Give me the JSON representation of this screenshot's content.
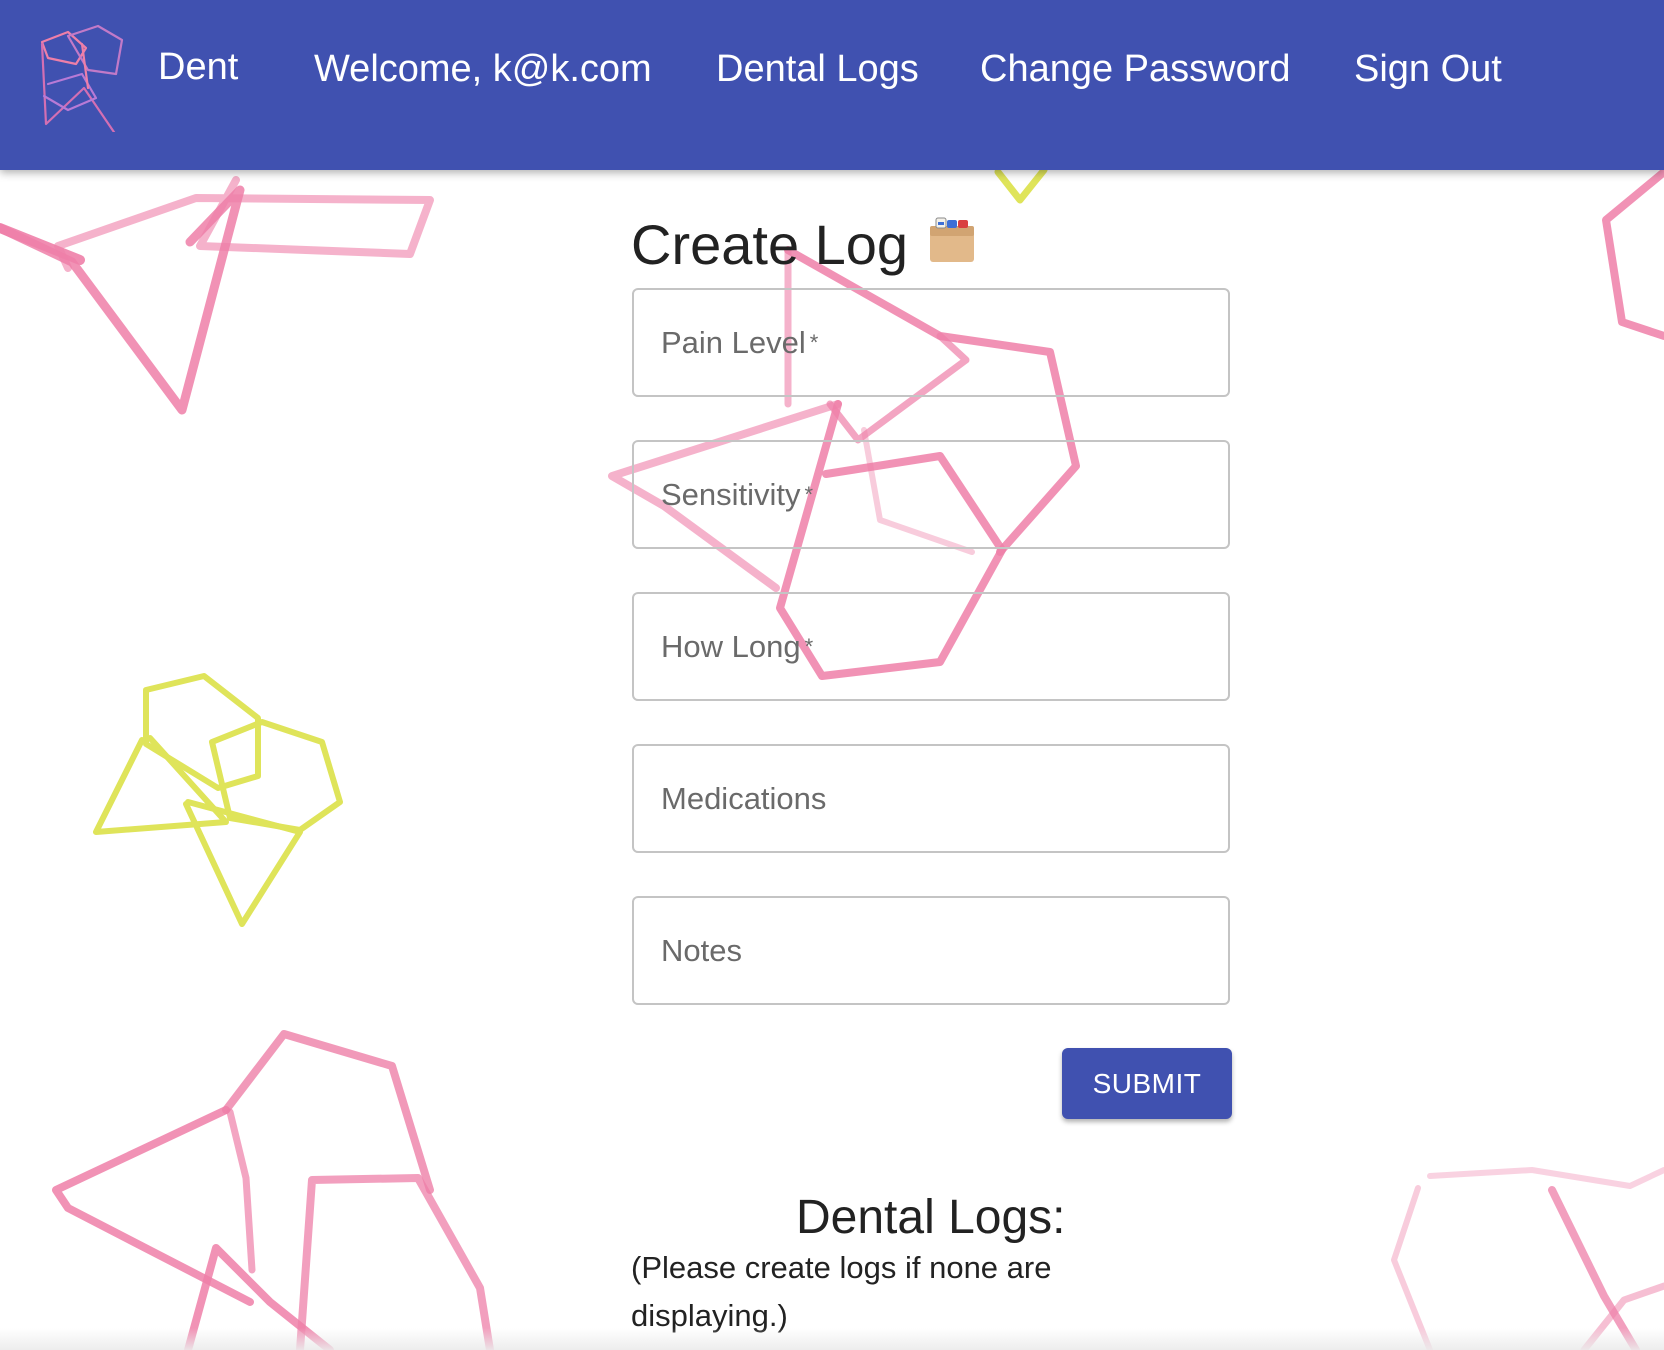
{
  "header": {
    "brand": "Dent",
    "welcome": "Welcome, k@k.com",
    "nav": {
      "dental_logs": "Dental Logs",
      "change_password": "Change Password",
      "sign_out": "Sign Out"
    }
  },
  "form": {
    "title": "Create Log",
    "title_icon": "card-file-box-icon",
    "fields": [
      {
        "label": "Pain Level",
        "required_mark": "*",
        "value": ""
      },
      {
        "label": "Sensitivity",
        "required_mark": "*",
        "value": ""
      },
      {
        "label": "How Long",
        "required_mark": "*",
        "value": ""
      },
      {
        "label": "Medications",
        "required_mark": "",
        "value": ""
      },
      {
        "label": "Notes",
        "required_mark": "",
        "value": ""
      }
    ],
    "submit_label": "SUBMIT"
  },
  "logs": {
    "heading": "Dental Logs:",
    "note": "(Please create logs if none are displaying.)"
  },
  "colors": {
    "primary": "#4051b0",
    "decor_pink": "#ee7fa8",
    "decor_yellow": "#dfe45a"
  }
}
